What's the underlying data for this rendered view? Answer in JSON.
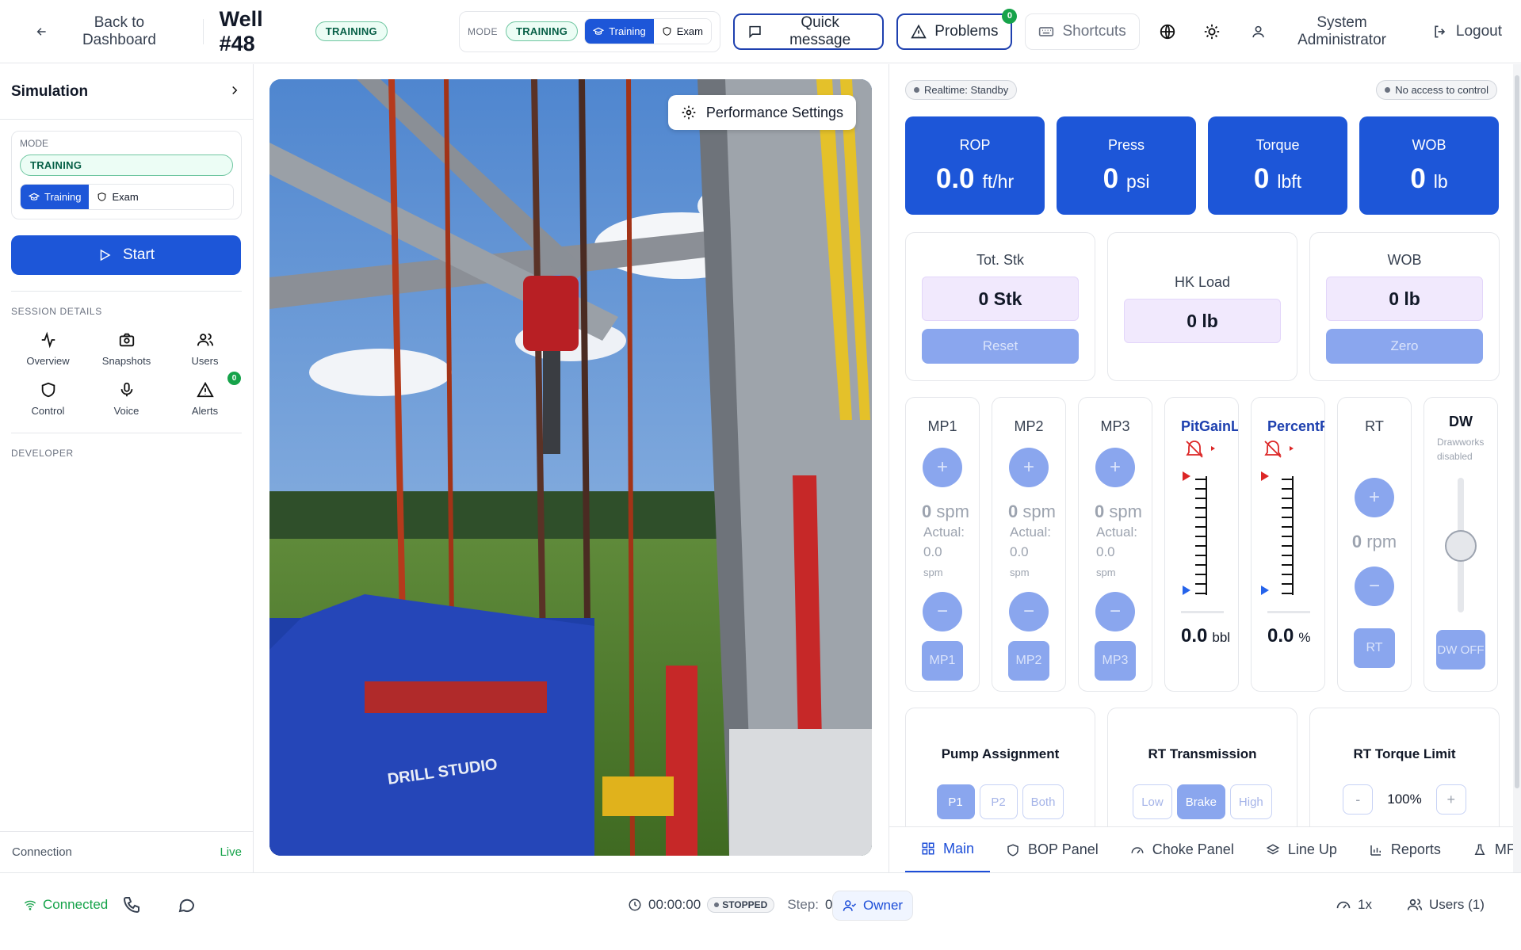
{
  "topbar": {
    "back_label": "Back to Dashboard",
    "well_title": "Well #48",
    "mode_badge": "TRAINING",
    "mode_label": "MODE",
    "mode_value": "TRAINING",
    "training_label": "Training",
    "exam_label": "Exam",
    "quick_message_label": "Quick message",
    "problems_label": "Problems",
    "problems_count": "0",
    "shortcuts_label": "Shortcuts",
    "user_label": "System Administrator",
    "logout_label": "Logout"
  },
  "sidebar": {
    "title": "Simulation",
    "mode_label": "MODE",
    "mode_value": "TRAINING",
    "training_label": "Training",
    "exam_label": "Exam",
    "start_label": "Start",
    "session_details_label": "SESSION DETAILS",
    "items": [
      {
        "label": "Overview",
        "icon": "activity-icon"
      },
      {
        "label": "Snapshots",
        "icon": "camera-icon"
      },
      {
        "label": "Users",
        "icon": "users-icon"
      },
      {
        "label": "Control",
        "icon": "shield-icon"
      },
      {
        "label": "Voice",
        "icon": "microphone-icon"
      },
      {
        "label": "Alerts",
        "icon": "alert-icon",
        "badge": "0"
      }
    ],
    "developer_label": "DEVELOPER",
    "connection_label": "Connection",
    "connection_status": "Live"
  },
  "viewport": {
    "performance_label": "Performance Settings",
    "brand_text": "DRILL STUDIO"
  },
  "panel": {
    "realtime_status": "Realtime: Standby",
    "access_status": "No access to control",
    "top_cards": [
      {
        "label": "ROP",
        "value": "0.0",
        "unit": "ft/hr"
      },
      {
        "label": "Press",
        "value": "0",
        "unit": "psi"
      },
      {
        "label": "Torque",
        "value": "0",
        "unit": "lbft"
      },
      {
        "label": "WOB",
        "value": "0",
        "unit": "lb"
      }
    ],
    "tot_stk": {
      "label": "Tot. Stk",
      "value": "0 Stk",
      "button": "Reset"
    },
    "hk_load": {
      "label": "HK Load",
      "value": "0 lb"
    },
    "wob": {
      "label": "WOB",
      "value": "0 lb",
      "button": "Zero"
    },
    "pumps": [
      {
        "name": "MP1",
        "value": "0",
        "unit": "spm",
        "actual_label": "Actual:",
        "actual": "0.0",
        "actual_unit": "spm",
        "button": "MP1"
      },
      {
        "name": "MP2",
        "value": "0",
        "unit": "spm",
        "actual_label": "Actual:",
        "actual": "0.0",
        "actual_unit": "spm",
        "button": "MP2"
      },
      {
        "name": "MP3",
        "value": "0",
        "unit": "spm",
        "actual_label": "Actual:",
        "actual": "0.0",
        "actual_unit": "spm",
        "button": "MP3"
      }
    ],
    "pit_gain": {
      "name": "PitGainLoss",
      "value": "0.0",
      "unit": "bbl"
    },
    "percent_flow": {
      "name": "PercentFlow",
      "value": "0.0",
      "unit": "%"
    },
    "rt": {
      "name": "RT",
      "value": "0",
      "unit": "rpm",
      "button": "RT"
    },
    "dw": {
      "name": "DW",
      "sub": "Drawworks disabled",
      "button": "DW OFF"
    },
    "pump_assignment": {
      "title": "Pump Assignment",
      "options": [
        "P1",
        "P2",
        "Both"
      ],
      "selected": "P1"
    },
    "rt_transmission": {
      "title": "RT Transmission",
      "options": [
        "Low",
        "Brake",
        "High"
      ],
      "selected": "Brake"
    },
    "rt_torque_limit": {
      "title": "RT Torque Limit",
      "minus": "-",
      "value": "100%",
      "plus": "+"
    },
    "tabs": [
      "Main",
      "BOP Panel",
      "Choke Panel",
      "Line Up",
      "Reports",
      "MFFI"
    ],
    "active_tab": "Main"
  },
  "bottombar": {
    "connected_label": "Connected",
    "timer": "00:00:00",
    "state": "STOPPED",
    "step_label": "Step:",
    "step_value": "0",
    "owner_label": "Owner",
    "speed": "1x",
    "users_label": "Users (1)"
  },
  "colors": {
    "primary": "#1d56d8",
    "primary_disabled": "#8aa6ee",
    "success": "#16a34a",
    "readout_bg": "#f1e9fd"
  }
}
